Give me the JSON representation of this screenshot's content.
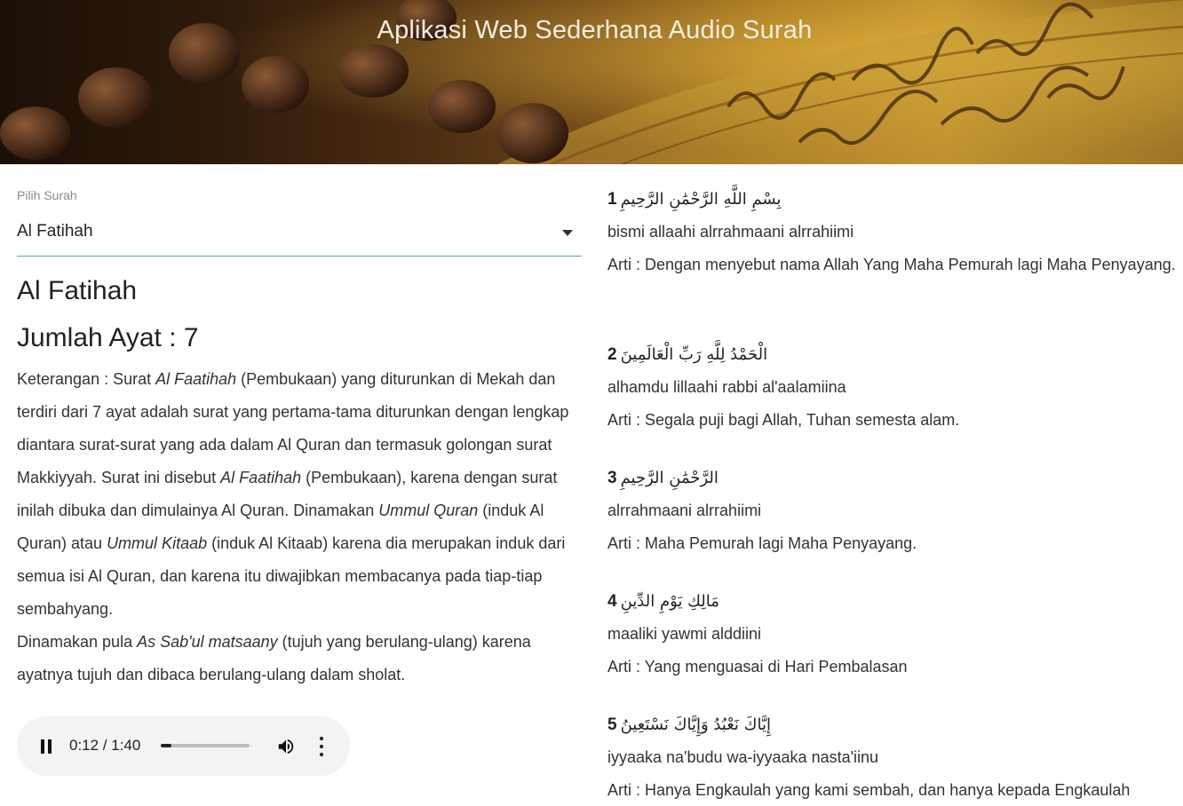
{
  "header": {
    "title": "Aplikasi Web Sederhana Audio Surah"
  },
  "select": {
    "label": "Pilih Surah",
    "value": "Al Fatihah"
  },
  "surah": {
    "name": "Al Fatihah",
    "jumlah_ayat": "Jumlah Ayat : 7",
    "desc_parts": [
      "Keterangan : Surat ",
      "Al Faatihah",
      " (Pembukaan) yang diturunkan di Mekah dan terdiri dari 7 ayat adalah surat yang pertama-tama diturunkan dengan lengkap diantara surat-surat yang ada dalam Al Quran dan termasuk golongan surat Makkiyyah. Surat ini disebut ",
      "Al Faatihah",
      " (Pembukaan), karena dengan surat inilah dibuka dan dimulainya Al Quran. Dinamakan ",
      "Ummul Quran",
      " (induk Al Quran) atau ",
      "Ummul Kitaab",
      " (induk Al Kitaab) karena dia merupakan induk dari semua isi Al Quran, dan karena itu diwajibkan membacanya pada tiap-tiap sembahyang.",
      "Dinamakan pula ",
      "As Sab'ul matsaany",
      " (tujuh yang berulang-ulang) karena ayatnya tujuh dan dibaca berulang-ulang dalam sholat."
    ]
  },
  "player": {
    "time": "0:12 / 1:40",
    "progress": 0.12,
    "icons": [
      "pause-icon",
      "volume-icon",
      "more-vert-icon"
    ]
  },
  "ayat": [
    {
      "num": "1",
      "arab": "بِسْمِ اللَّهِ الرَّحْمَٰنِ الرَّحِيمِ",
      "latin": "bismi allaahi alrrahmaani alrrahiimi",
      "arti": "Arti : Dengan menyebut nama Allah Yang Maha Pemurah lagi Maha Penyayang."
    },
    {
      "num": "2",
      "arab": "الْحَمْدُ لِلَّهِ رَبِّ الْعَالَمِينَ",
      "latin": "alhamdu lillaahi rabbi al'aalamiina",
      "arti": "Arti : Segala puji bagi Allah, Tuhan semesta alam."
    },
    {
      "num": "3",
      "arab": "الرَّحْمَٰنِ الرَّحِيمِ",
      "latin": "alrrahmaani alrrahiimi",
      "arti": "Arti : Maha Pemurah lagi Maha Penyayang."
    },
    {
      "num": "4",
      "arab": "مَالِكِ يَوْمِ الدِّينِ",
      "latin": "maaliki yawmi alddiini",
      "arti": "Arti : Yang menguasai di Hari Pembalasan"
    },
    {
      "num": "5",
      "arab": "إِيَّاكَ نَعْبُدُ وَإِيَّاكَ نَسْتَعِينُ",
      "latin": "iyyaaka na'budu wa-iyyaaka nasta'iinu",
      "arti": "Arti : Hanya Engkaulah yang kami sembah, dan hanya kepada Engkaulah"
    }
  ]
}
